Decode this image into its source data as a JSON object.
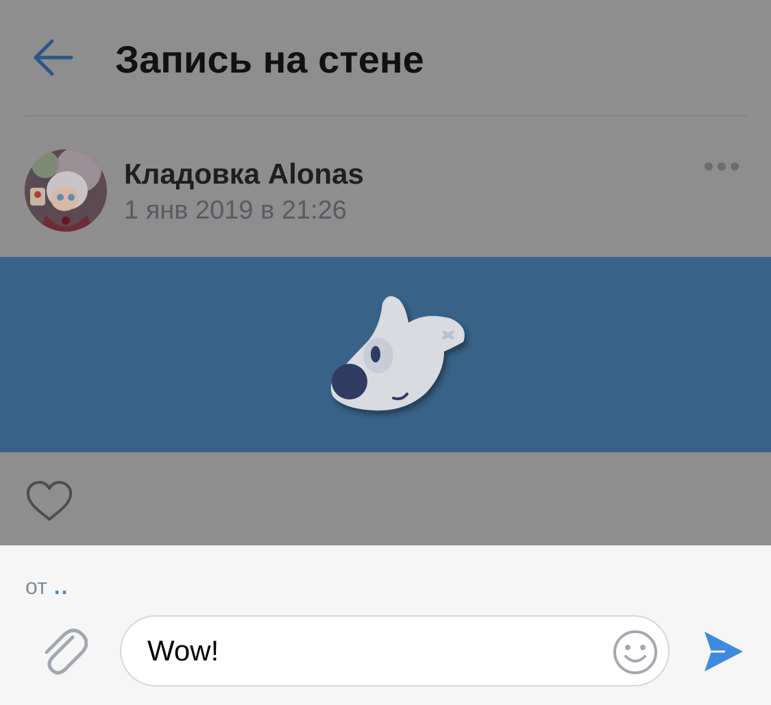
{
  "header": {
    "title": "Запись на стене",
    "back_icon": "back-arrow-icon"
  },
  "post": {
    "author_name": "Кладовка Alonas",
    "date": "1 янв 2019 в 21:26",
    "more_icon": "more-dots-icon",
    "image_icon": "dog-mascot-icon",
    "like_icon": "heart-icon"
  },
  "composer": {
    "from_label": "от",
    "from_value": "..",
    "message_value": "Wow!",
    "attach_icon": "paperclip-icon",
    "emoji_icon": "smile-icon",
    "send_icon": "send-icon"
  },
  "colors": {
    "dim_overlay": "#8e8e8e",
    "banner": "#386287",
    "accent_blue": "#4a86c5",
    "send_blue": "#3f8ae0",
    "composer_bg": "#f6f6f6"
  }
}
